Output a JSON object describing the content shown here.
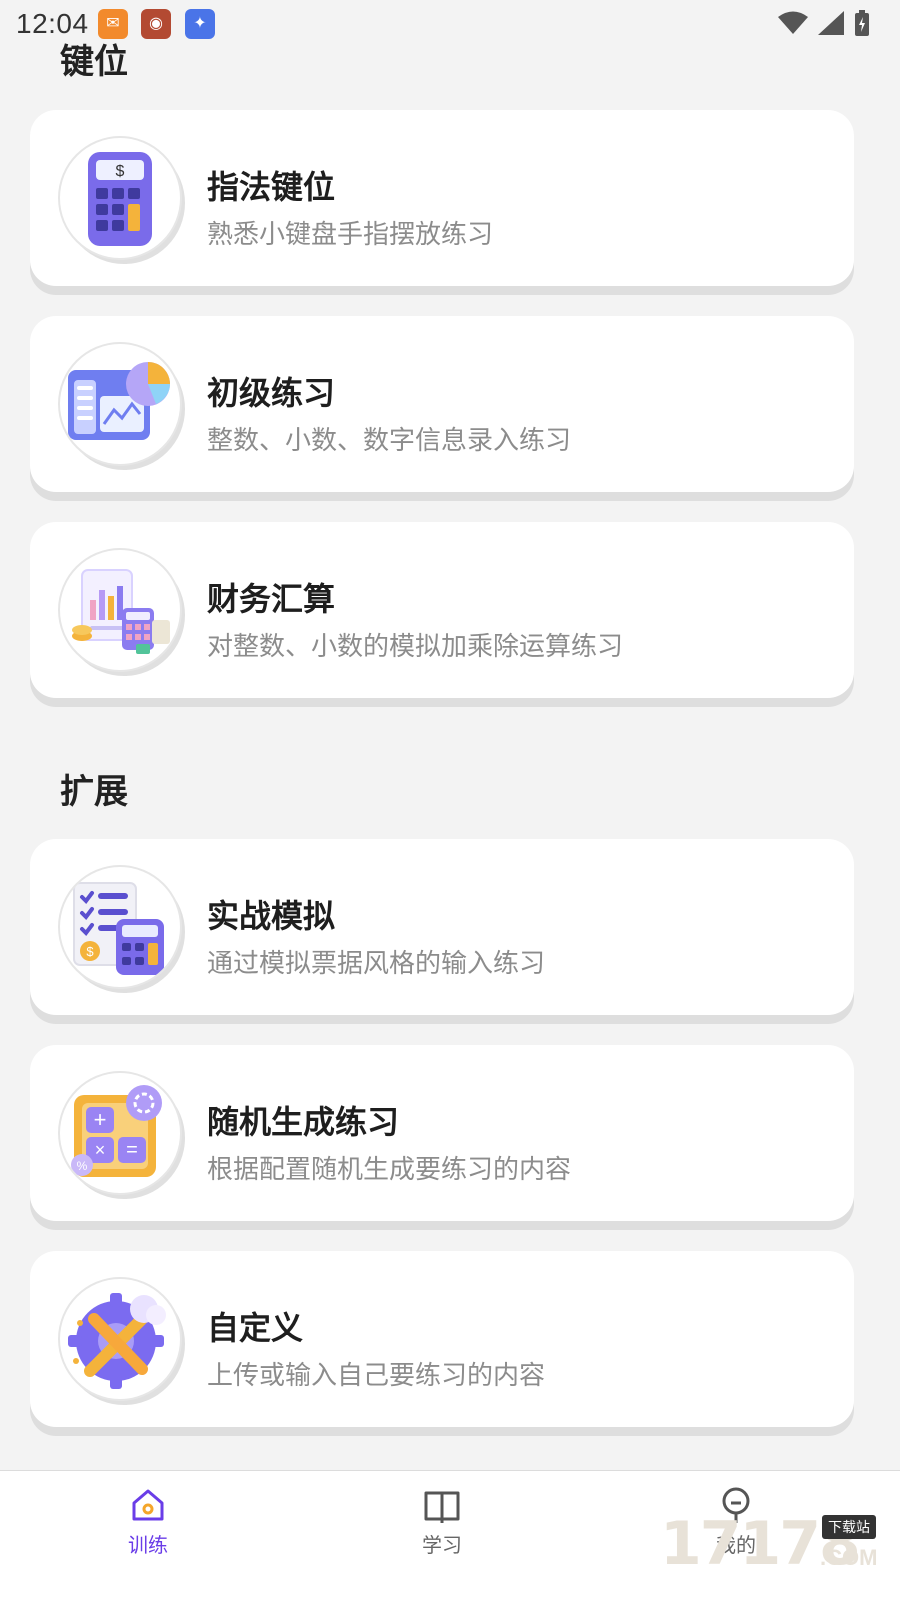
{
  "status_bar": {
    "time": "12:04"
  },
  "sections": [
    {
      "title": "键位"
    },
    {
      "title": "扩展"
    }
  ],
  "cards": [
    {
      "title": "指法键位",
      "desc": "熟悉小键盘手指摆放练习",
      "icon": "calculator-icon"
    },
    {
      "title": "初级练习",
      "desc": "整数、小数、数字信息录入练习",
      "icon": "dashboard-chart-icon"
    },
    {
      "title": "财务汇算",
      "desc": "对整数、小数的模拟加乘除运算练习",
      "icon": "finance-report-icon"
    },
    {
      "title": "实战模拟",
      "desc": "通过模拟票据风格的输入练习",
      "icon": "checklist-calculator-icon"
    },
    {
      "title": "随机生成练习",
      "desc": "根据配置随机生成要练习的内容",
      "icon": "math-operations-icon"
    },
    {
      "title": "自定义",
      "desc": "上传或输入自己要练习的内容",
      "icon": "settings-tools-icon"
    }
  ],
  "bottom_nav": {
    "items": [
      {
        "label": "训练",
        "icon": "home-icon",
        "active": true
      },
      {
        "label": "学习",
        "icon": "book-icon",
        "active": false
      },
      {
        "label": "我的",
        "icon": "profile-icon",
        "active": false
      }
    ]
  },
  "watermark": {
    "number": "17178",
    "tag": "下载站",
    "suffix": ".COM"
  },
  "colors": {
    "accent": "#6a3de8",
    "background": "#f3f3f3",
    "card": "#ffffff"
  }
}
